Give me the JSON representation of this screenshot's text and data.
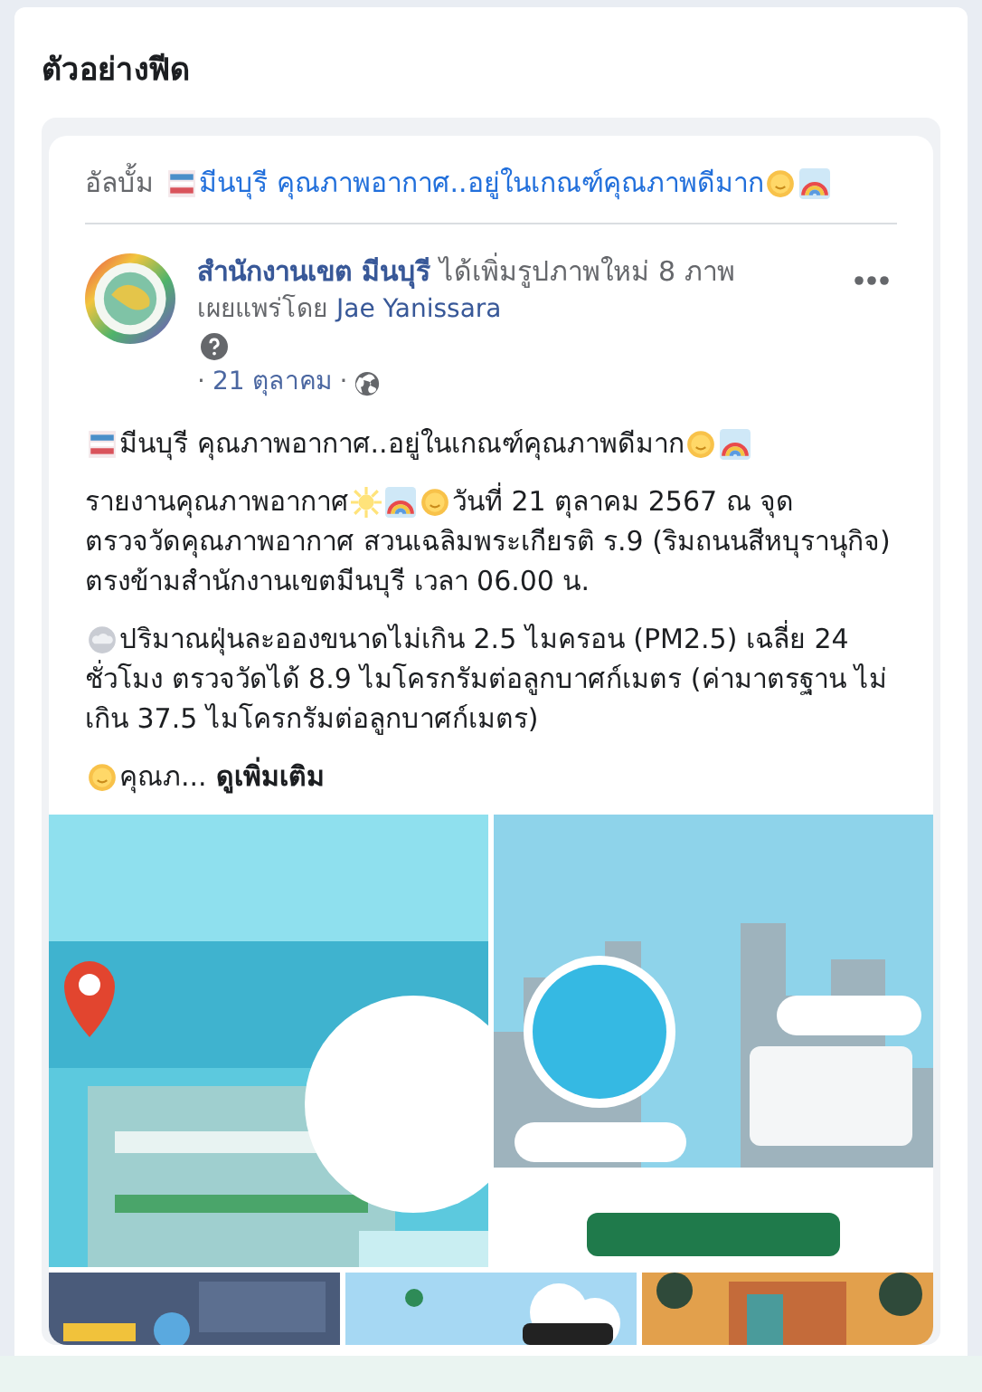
{
  "panel": {
    "title": "ตัวอย่างฟีด"
  },
  "album": {
    "label": "อัลบั้ม",
    "title": "มีนบุรี คุณภาพอากาศ..อยู่ในเกณฑ์คุณภาพดีมาก"
  },
  "post": {
    "page_name": "สำนักงานเขต มีนบุรี",
    "action": "ได้เพิ่มรูปภาพใหม่ 8 ภาพ",
    "published_by": "เผยแพร่โดย",
    "publisher": "Jae Yanissara",
    "date": "21 ตุลาคม",
    "separator": "·",
    "paragraphs": [
      {
        "lines": [
          [
            "มีนบุรี คุณภาพอากาศ..อยู่ในเกณฑ์คุณภาพดีมาก"
          ]
        ]
      },
      {
        "lines": [
          [
            "รายงานคุณภาพอากาศ",
            "วันที่ 21 ตุลาคม 2567 ณ จุด"
          ],
          [
            "ตรวจวัดคุณภาพอากาศ สวนเฉลิมพระเกียรติ ร.9 (ริมถนนสีหบุรานุกิจ) ตรงข้ามสำนักงานเขตมีนบุรี เวลา 06.00 น."
          ]
        ]
      },
      {
        "lines": [
          [
            "ปริมาณฝุ่นละอองขนาดไม่เกิน 2.5 ไมครอน (PM2.5) เฉลี่ย 24"
          ],
          [
            "ชั่วโมง ตรวจวัดได้ 8.9 ไมโครกรัมต่อลูกบาศก์เมตร (ค่ามาตรฐาน ไม่เกิน 37.5 ไมโครกรัมต่อลูกบาศก์เมตร)"
          ]
        ]
      },
      {
        "lines": [
          [
            "คุณภ..."
          ]
        ],
        "more": "ดูเพิ่มเติม"
      }
    ]
  }
}
